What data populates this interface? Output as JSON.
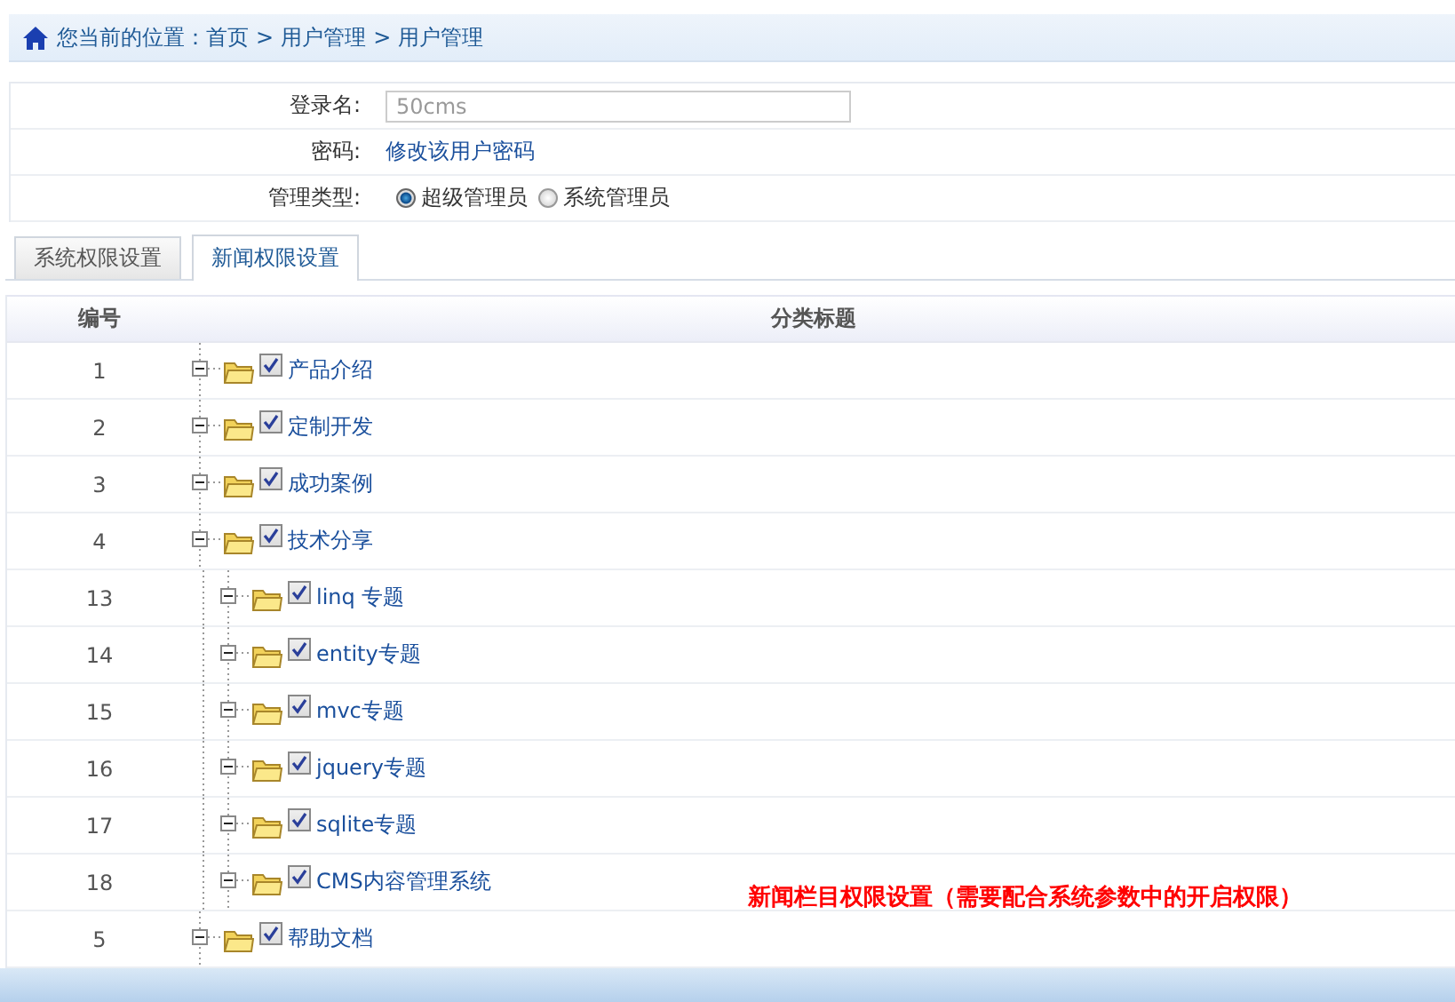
{
  "breadcrumb": {
    "prefix": "您当前的位置：",
    "items": [
      "首页",
      "用户管理",
      "用户管理"
    ],
    "separator": ">"
  },
  "form": {
    "login": {
      "label": "登录名:",
      "value": "50cms"
    },
    "password": {
      "label": "密码:",
      "link": "修改该用户密码"
    },
    "admin_type": {
      "label": "管理类型:",
      "options": [
        {
          "label": "超级管理员",
          "selected": true
        },
        {
          "label": "系统管理员",
          "selected": false
        }
      ]
    }
  },
  "tabs": [
    {
      "label": "系统权限设置",
      "selected": false
    },
    {
      "label": "新闻权限设置",
      "selected": true
    }
  ],
  "table": {
    "columns": [
      "编号",
      "分类标题"
    ],
    "rows": [
      {
        "id": "1",
        "title": "产品介绍",
        "checked": true,
        "expanded": true
      },
      {
        "id": "2",
        "title": "定制开发",
        "checked": true,
        "expanded": true
      },
      {
        "id": "3",
        "title": "成功案例",
        "checked": true,
        "expanded": true
      },
      {
        "id": "4",
        "title": "技术分享",
        "checked": true,
        "expanded": true,
        "children": [
          {
            "id": "13",
            "title": "linq 专题",
            "checked": true,
            "expanded": true
          },
          {
            "id": "14",
            "title": "entity专题",
            "checked": true,
            "expanded": true
          },
          {
            "id": "15",
            "title": "mvc专题",
            "checked": true,
            "expanded": true
          },
          {
            "id": "16",
            "title": "jquery专题",
            "checked": true,
            "expanded": true
          },
          {
            "id": "17",
            "title": "sqlite专题",
            "checked": true,
            "expanded": true
          },
          {
            "id": "18",
            "title": "CMS内容管理系统",
            "checked": true,
            "expanded": true
          }
        ]
      },
      {
        "id": "5",
        "title": "帮助文档",
        "checked": true,
        "expanded": true
      }
    ]
  },
  "note": "新闻栏目权限设置（需要配合系统参数中的开启权限）"
}
